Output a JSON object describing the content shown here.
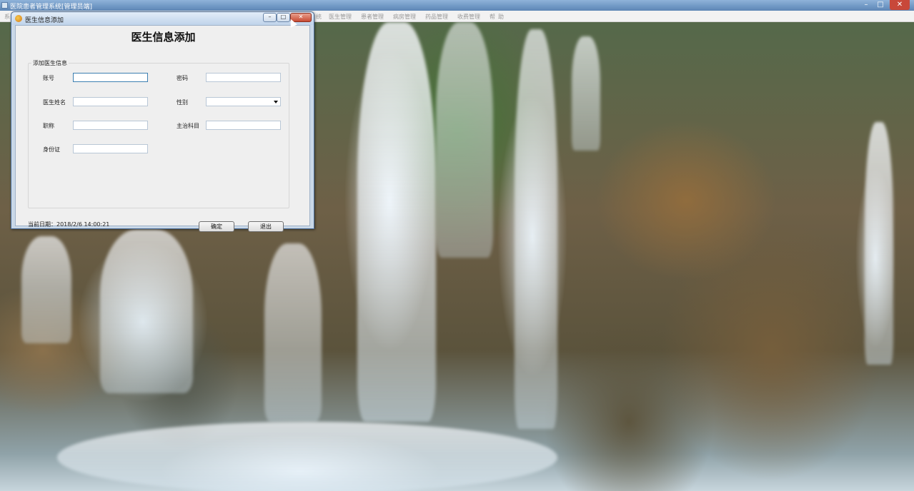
{
  "main_window": {
    "title": "医院患者管理系统[管理员端]",
    "controls": {
      "minimize": "–",
      "maximize": "□",
      "close": "✕"
    },
    "menu_items": [
      "系",
      "统",
      "医生管理",
      "患者管理",
      "病房管理",
      "药品管理",
      "收费管理",
      "帮",
      "助"
    ]
  },
  "dialog": {
    "title": "医生信息添加",
    "heading": "医生信息添加",
    "group_title": "添加医生信息",
    "fields": {
      "account": {
        "label": "账号",
        "value": ""
      },
      "password": {
        "label": "密码",
        "value": ""
      },
      "doctor_name": {
        "label": "医生姓名",
        "value": ""
      },
      "gender": {
        "label": "性别",
        "value": ""
      },
      "title": {
        "label": "职称",
        "value": ""
      },
      "department": {
        "label": "主治科目",
        "value": ""
      },
      "id_card": {
        "label": "身份证",
        "value": ""
      }
    },
    "status": "当前日期：2018/2/6 14:00:21",
    "buttons": {
      "confirm": "确定",
      "exit": "退出"
    },
    "controls": {
      "minimize": "–",
      "maximize": "□",
      "close": "✕"
    }
  },
  "colors": {
    "titlebar_accent": "#6f97c4",
    "close_red": "#c74a33",
    "form_background": "#efefef"
  },
  "icons": [
    "app-icon",
    "dialog-app-icon",
    "minimize-icon",
    "maximize-icon",
    "close-icon",
    "dropdown-arrow-icon",
    "mouse-cursor-icon"
  ]
}
